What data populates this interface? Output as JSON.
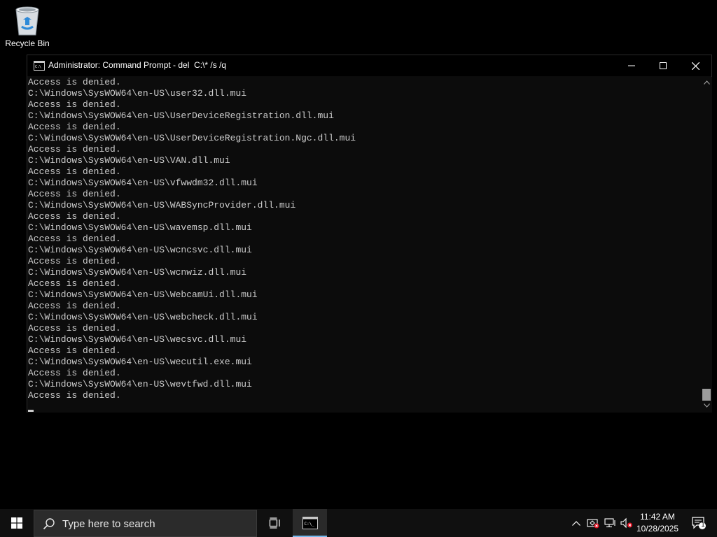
{
  "desktop": {
    "recycle_bin_label": "Recycle Bin"
  },
  "window": {
    "title": "Administrator: Command Prompt - del  C:\\* /s /q"
  },
  "console": {
    "lines": [
      "Access is denied.",
      "C:\\Windows\\SysWOW64\\en-US\\user32.dll.mui",
      "Access is denied.",
      "C:\\Windows\\SysWOW64\\en-US\\UserDeviceRegistration.dll.mui",
      "Access is denied.",
      "C:\\Windows\\SysWOW64\\en-US\\UserDeviceRegistration.Ngc.dll.mui",
      "Access is denied.",
      "C:\\Windows\\SysWOW64\\en-US\\VAN.dll.mui",
      "Access is denied.",
      "C:\\Windows\\SysWOW64\\en-US\\vfwwdm32.dll.mui",
      "Access is denied.",
      "C:\\Windows\\SysWOW64\\en-US\\WABSyncProvider.dll.mui",
      "Access is denied.",
      "C:\\Windows\\SysWOW64\\en-US\\wavemsp.dll.mui",
      "Access is denied.",
      "C:\\Windows\\SysWOW64\\en-US\\wcncsvc.dll.mui",
      "Access is denied.",
      "C:\\Windows\\SysWOW64\\en-US\\wcnwiz.dll.mui",
      "Access is denied.",
      "C:\\Windows\\SysWOW64\\en-US\\WebcamUi.dll.mui",
      "Access is denied.",
      "C:\\Windows\\SysWOW64\\en-US\\webcheck.dll.mui",
      "Access is denied.",
      "C:\\Windows\\SysWOW64\\en-US\\wecsvc.dll.mui",
      "Access is denied.",
      "C:\\Windows\\SysWOW64\\en-US\\wecutil.exe.mui",
      "Access is denied.",
      "C:\\Windows\\SysWOW64\\en-US\\wevtfwd.dll.mui",
      "Access is denied."
    ]
  },
  "taskbar": {
    "search_placeholder": "Type here to search",
    "clock_time": "11:42 AM",
    "clock_date": "10/28/2025",
    "notification_count": "1"
  },
  "colors": {
    "console_bg": "#0c0c0c",
    "console_text": "#cccccc",
    "taskbar_bg": "#101010",
    "accent": "#76b9ed"
  }
}
